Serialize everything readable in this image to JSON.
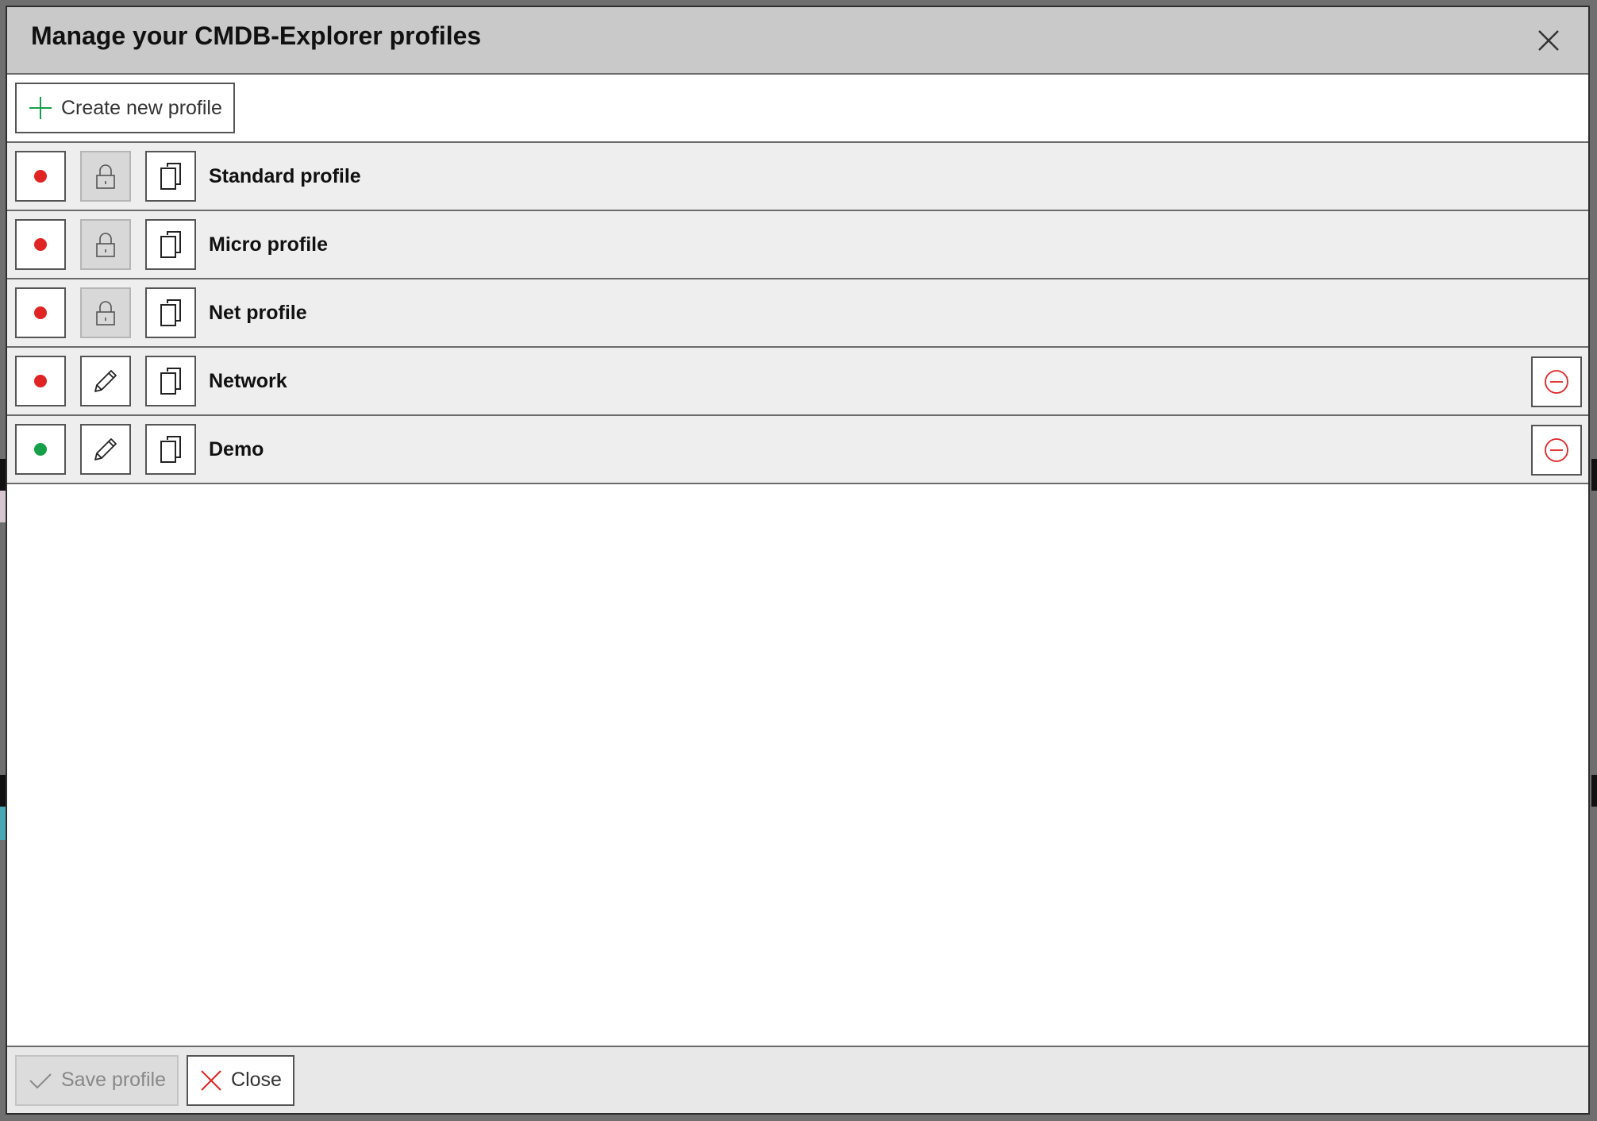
{
  "dialog": {
    "title": "Manage your CMDB-Explorer profiles",
    "close_icon": "close-icon"
  },
  "toolbar": {
    "create_label": "Create new profile",
    "create_icon": "plus-icon"
  },
  "colors": {
    "inactive_dot": "#e02424",
    "active_dot": "#16a04a",
    "danger": "#e02424",
    "accent_green": "#16a04a"
  },
  "profiles": [
    {
      "name": "Standard profile",
      "status": "inactive",
      "editable": false,
      "deletable": false
    },
    {
      "name": "Micro profile",
      "status": "inactive",
      "editable": false,
      "deletable": false
    },
    {
      "name": "Net profile",
      "status": "inactive",
      "editable": false,
      "deletable": false
    },
    {
      "name": "Network",
      "status": "inactive",
      "editable": true,
      "deletable": true
    },
    {
      "name": "Demo",
      "status": "active",
      "editable": true,
      "deletable": true
    }
  ],
  "footer": {
    "save_label": "Save profile",
    "save_icon": "checkmark-icon",
    "close_label": "Close",
    "close_icon": "close-icon"
  }
}
